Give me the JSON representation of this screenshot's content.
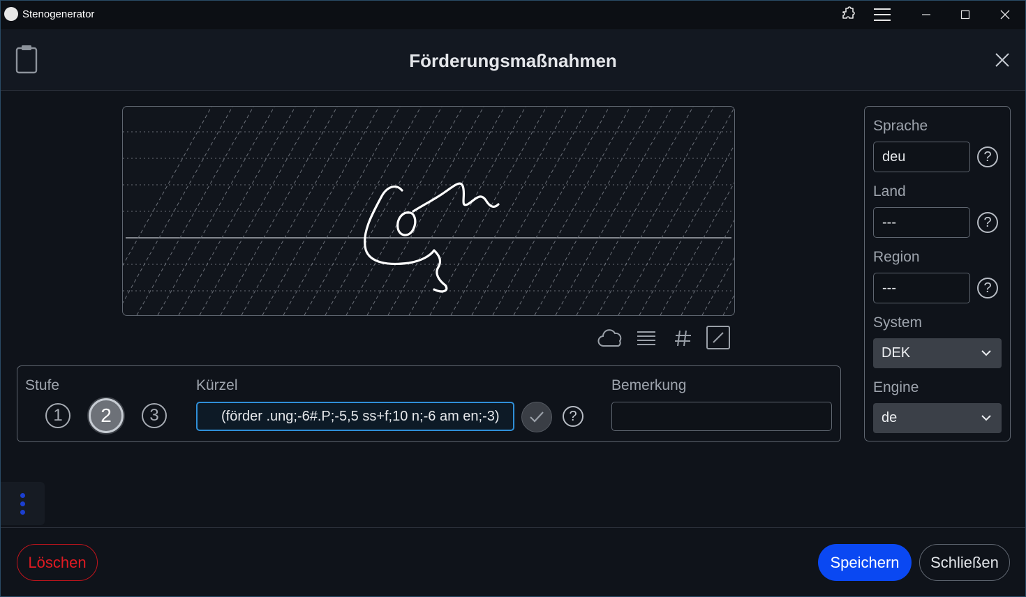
{
  "window": {
    "title": "Stenogenerator"
  },
  "dialog": {
    "title": "Förderungsmaßnahmen"
  },
  "panel": {
    "stufe_label": "Stufe",
    "stufe_options": [
      "1",
      "2",
      "3"
    ],
    "stufe_selected": "2",
    "kuerzel_label": "Kürzel",
    "kuerzel_value": "(förder .ung;-6#.P;-5,5 ss+f;10 n;-6 am en;-3)",
    "bemerkung_label": "Bemerkung",
    "bemerkung_value": ""
  },
  "side": {
    "sprache_label": "Sprache",
    "sprache_value": "deu",
    "land_label": "Land",
    "land_value": "---",
    "region_label": "Region",
    "region_value": "---",
    "system_label": "System",
    "system_value": "DEK",
    "engine_label": "Engine",
    "engine_value": "de"
  },
  "toolbar_icons": [
    "cloud-icon",
    "lines-icon",
    "hash-icon",
    "slash-box-icon"
  ],
  "footer": {
    "delete_label": "Löschen",
    "save_label": "Speichern",
    "close_label": "Schließen"
  },
  "colors": {
    "accent": "#0a48f2",
    "danger": "#e01a22",
    "focus": "#2f8fd8"
  }
}
